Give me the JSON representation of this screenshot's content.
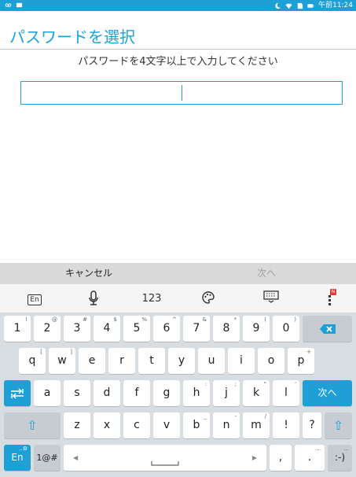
{
  "status_bar": {
    "time": "午前11:24"
  },
  "app": {
    "title": "パスワードを選択"
  },
  "prompt": "パスワードを4文字以上で入力してください",
  "password_field": {
    "value": ""
  },
  "actions": {
    "cancel": "キャンセル",
    "next": "次へ"
  },
  "keyboard_toolbar": {
    "lang": "En",
    "numbers": "123",
    "notification_badge": "N"
  },
  "keyboard": {
    "row1": [
      {
        "label": "1",
        "hint": "!"
      },
      {
        "label": "2",
        "hint": "@"
      },
      {
        "label": "3",
        "hint": "#"
      },
      {
        "label": "4",
        "hint": "$"
      },
      {
        "label": "5",
        "hint": "%"
      },
      {
        "label": "6",
        "hint": "^"
      },
      {
        "label": "7",
        "hint": "&"
      },
      {
        "label": "8",
        "hint": "*"
      },
      {
        "label": "9",
        "hint": "("
      },
      {
        "label": "0",
        "hint": ")"
      }
    ],
    "row2": [
      {
        "label": "q",
        "hint": "["
      },
      {
        "label": "w",
        "hint": "]"
      },
      {
        "label": "e",
        "hint": ""
      },
      {
        "label": "r",
        "hint": ""
      },
      {
        "label": "t",
        "hint": ""
      },
      {
        "label": "y",
        "hint": ""
      },
      {
        "label": "u",
        "hint": ""
      },
      {
        "label": "i",
        "hint": ""
      },
      {
        "label": "o",
        "hint": ""
      },
      {
        "label": "p",
        "hint": "+"
      }
    ],
    "row3": [
      {
        "label": "a",
        "hint": ""
      },
      {
        "label": "s",
        "hint": ""
      },
      {
        "label": "d",
        "hint": ""
      },
      {
        "label": "f",
        "hint": ""
      },
      {
        "label": "g",
        "hint": ""
      },
      {
        "label": "h",
        "hint": ":"
      },
      {
        "label": "j",
        "hint": ";"
      },
      {
        "label": "k",
        "hint": "\""
      },
      {
        "label": "l",
        "hint": "'"
      }
    ],
    "row4": [
      {
        "label": "z",
        "hint": ""
      },
      {
        "label": "x",
        "hint": ""
      },
      {
        "label": "c",
        "hint": ""
      },
      {
        "label": "v",
        "hint": ""
      },
      {
        "label": "b",
        "hint": "_"
      },
      {
        "label": "n",
        "hint": "-"
      },
      {
        "label": "m",
        "hint": "/"
      },
      {
        "label": "!",
        "hint": ""
      },
      {
        "label": "?",
        "hint": ""
      }
    ],
    "enter_label": "次へ",
    "lang_key": "En",
    "symbols_key": "1@#",
    "comma": ",",
    "period": ".",
    "smiley": ":-)",
    "smiley_hint": "..."
  },
  "colors": {
    "accent": "#1e9fd6",
    "action_bar": "#dadada",
    "keyboard_bg": "#d8dde1"
  }
}
